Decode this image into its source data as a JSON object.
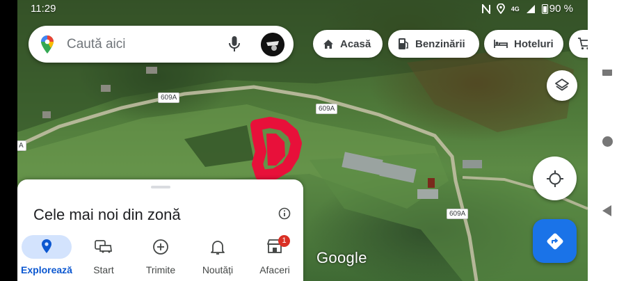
{
  "status_bar": {
    "time": "11:29",
    "network": "4G",
    "battery": "90 %"
  },
  "search": {
    "placeholder": "Caută aici"
  },
  "chips": [
    {
      "label": "Acasă",
      "icon": "home-icon"
    },
    {
      "label": "Benzinării",
      "icon": "gas-station-icon"
    },
    {
      "label": "Hoteluri",
      "icon": "hotel-bed-icon"
    },
    {
      "label": "",
      "icon": "shopping-cart-icon"
    }
  ],
  "map": {
    "road_labels": [
      "609A",
      "609A",
      "609A",
      "A"
    ],
    "attribution": "Google"
  },
  "bottom_sheet": {
    "title": "Cele mai noi din zonă",
    "tabs": [
      {
        "label": "Explorează",
        "icon": "location-pin-icon",
        "active": true
      },
      {
        "label": "Start",
        "icon": "car-commute-icon",
        "active": false
      },
      {
        "label": "Trimite",
        "icon": "add-circle-icon",
        "active": false
      },
      {
        "label": "Noutăți",
        "icon": "bell-icon",
        "active": false
      },
      {
        "label": "Afaceri",
        "icon": "store-icon",
        "active": false,
        "badge": "1"
      }
    ]
  },
  "colors": {
    "accent": "#1a73e8",
    "active_tab_bg": "#d3e3fd",
    "badge": "#d93025",
    "marker": "#e8103a"
  }
}
